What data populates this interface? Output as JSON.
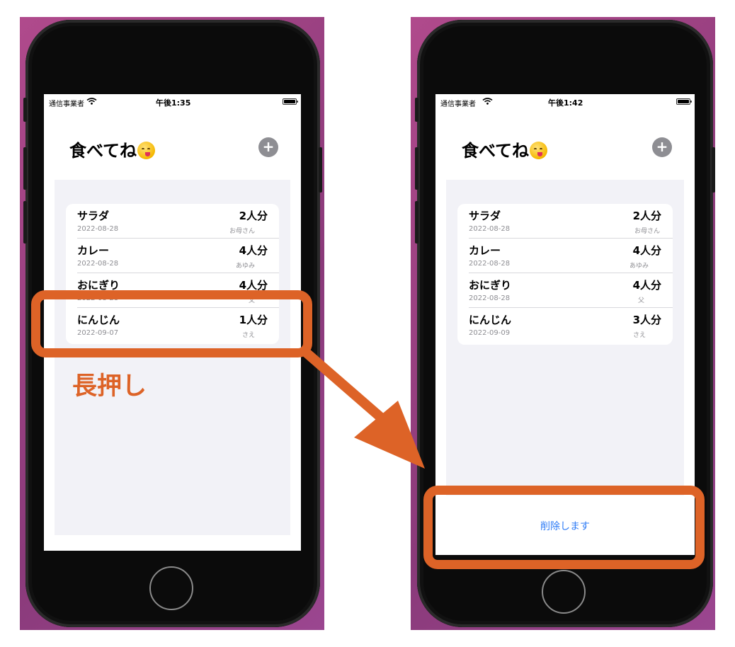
{
  "left_screen": {
    "status": {
      "carrier": "通信事業者",
      "time": "午後1:35"
    },
    "title": "食べてね",
    "add_button": "+",
    "items": [
      {
        "name": "サラダ",
        "date": "2022-08-28",
        "qty": "2人分",
        "who": "お母さん"
      },
      {
        "name": "カレー",
        "date": "2022-08-28",
        "qty": "4人分",
        "who": "あゆみ"
      },
      {
        "name": "おにぎり",
        "date": "2022-08-28",
        "qty": "4人分",
        "who": "父"
      },
      {
        "name": "にんじん",
        "date": "2022-09-07",
        "qty": "1人分",
        "who": "さえ"
      }
    ]
  },
  "right_screen": {
    "status": {
      "carrier": "通信事業者",
      "time": "午後1:42"
    },
    "title": "食べてね",
    "add_button": "+",
    "items": [
      {
        "name": "サラダ",
        "date": "2022-08-28",
        "qty": "2人分",
        "who": "お母さん"
      },
      {
        "name": "カレー",
        "date": "2022-08-28",
        "qty": "4人分",
        "who": "あゆみ"
      },
      {
        "name": "おにぎり",
        "date": "2022-08-28",
        "qty": "4人分",
        "who": "父"
      },
      {
        "name": "にんじん",
        "date": "2022-09-09",
        "qty": "3人分",
        "who": "さえ"
      }
    ],
    "action_sheet": {
      "delete_label": "削除します"
    }
  },
  "annotation": {
    "callout": "長押し",
    "accent_color": "#dd6327"
  },
  "icons": [
    "wifi-icon",
    "battery-icon",
    "plus-icon",
    "smiling-face-emoji-icon",
    "arrow-icon"
  ]
}
